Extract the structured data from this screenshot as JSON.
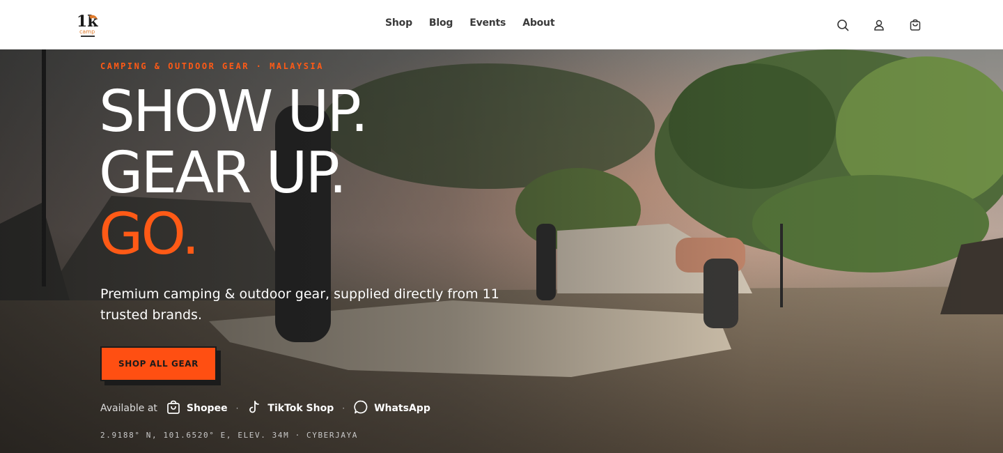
{
  "header": {
    "logo_text": "1k camp",
    "nav": [
      "Shop",
      "Blog",
      "Events",
      "About"
    ],
    "icons": [
      "search-icon",
      "account-icon",
      "cart-icon"
    ]
  },
  "hero": {
    "kicker": "CAMPING & OUTDOOR GEAR · MALAYSIA",
    "headline": [
      "SHOW UP.",
      "GEAR UP.",
      "GO."
    ],
    "subtitle": "Premium camping & outdoor gear, supplied directly from 11 trusted brands.",
    "cta": "SHOP ALL GEAR",
    "available_label": "Available at",
    "stores": [
      "Shopee",
      "TikTok Shop",
      "WhatsApp"
    ],
    "coordinates": "2.9188° N, 101.6520° E, ELEV. 34M · CYBERJAYA"
  },
  "colors": {
    "accent": "#ff5a16",
    "header_bg": "#ffffff",
    "nav_text": "#3a3a3a"
  }
}
